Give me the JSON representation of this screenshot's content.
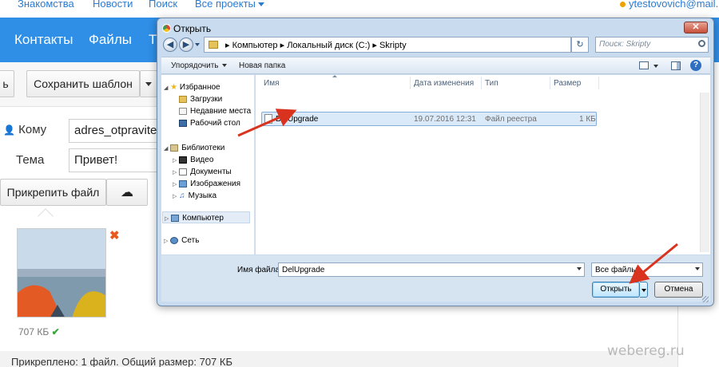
{
  "topnav": {
    "links": [
      "Знакомства",
      "Новости",
      "Поиск",
      "Все проекты"
    ],
    "user": "ytestovovich@mail."
  },
  "mainnav": {
    "tabs": [
      "Контакты",
      "Файлы",
      "Т"
    ]
  },
  "toolbar": {
    "send_partial": "ь",
    "save_template": "Сохранить шаблон"
  },
  "compose": {
    "to_label": "Кому",
    "to_value": "adres_otpravite",
    "subject_label": "Тема",
    "subject_value": "Привет!",
    "attach_label": "Прикрепить файл"
  },
  "attachment": {
    "size": "707 КБ"
  },
  "footer_text": "Прикреплено: 1 файл. Общий размер: 707 КБ",
  "dialog": {
    "title": "Открыть",
    "breadcrumb": [
      "Компьютер",
      "Локальный диск (C:)",
      "Skripty"
    ],
    "search_placeholder": "Поиск: Skripty",
    "commands": {
      "organize": "Упорядочить",
      "new_folder": "Новая папка"
    },
    "nav": {
      "favorites": "Избранное",
      "downloads": "Загрузки",
      "recent": "Недавние места",
      "desktop": "Рабочий стол",
      "libraries": "Библиотеки",
      "video": "Видео",
      "documents": "Документы",
      "pictures": "Изображения",
      "music": "Музыка",
      "computer": "Компьютер",
      "network": "Сеть"
    },
    "columns": {
      "name": "Имя",
      "date": "Дата изменения",
      "type": "Тип",
      "size": "Размер"
    },
    "file": {
      "name": "DelUpgrade",
      "date": "19.07.2016 12:31",
      "type": "Файл реестра",
      "size": "1 КБ"
    },
    "filename_label": "Имя файла:",
    "filename_value": "DelUpgrade",
    "filetype": "Все файлы",
    "open_label": "Открыть",
    "cancel_label": "Отмена"
  },
  "watermark": "webereg.ru",
  "colors": {
    "mail_blue": "#2f8ee6",
    "link_blue": "#2b7bd1",
    "arrow_red": "#d9331f",
    "delete_x": "#e8591e",
    "check_green": "#3aa53a"
  }
}
